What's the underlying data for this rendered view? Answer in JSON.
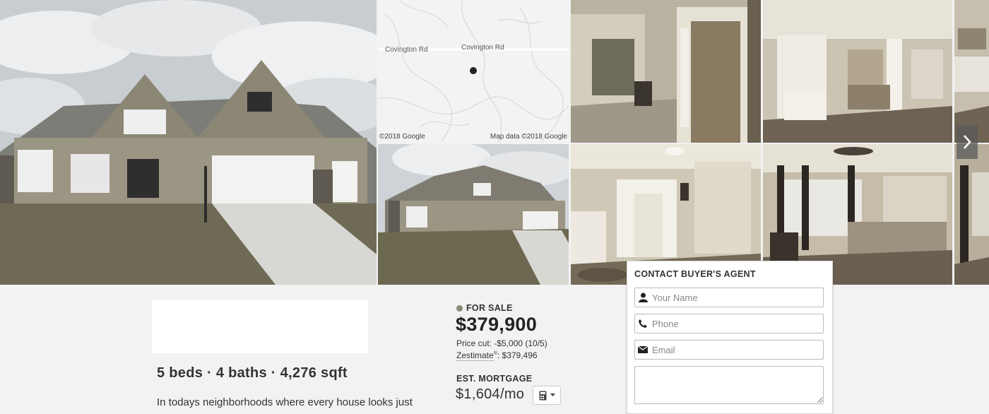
{
  "gallery": {
    "map": {
      "road_label_left": "Covington Rd",
      "road_label_right": "Covington Rd",
      "copyright_left": "©2018 Google",
      "copyright_right": "Map data ©2018 Google"
    },
    "next_icon": "chevron-right-icon"
  },
  "listing": {
    "facts": "5 beds · 4 baths · 4,276 sqft",
    "description": "In todays neighborhoods where every house looks just",
    "status": "FOR SALE",
    "status_color": "#8a8a7a",
    "price": "$379,900",
    "price_cut": "Price cut: -$5,000 (10/5)",
    "zestimate_label": "Zestimate",
    "zestimate_mark": "®",
    "zestimate_value": ": $379,496",
    "mortgage_label": "EST. MORTGAGE",
    "mortgage_value": "$1,604/mo",
    "calculator_icon": "calculator-icon"
  },
  "contact": {
    "title": "CONTACT BUYER'S AGENT",
    "name_placeholder": "Your Name",
    "phone_placeholder": "Phone",
    "email_placeholder": "Email",
    "message_value": ""
  }
}
